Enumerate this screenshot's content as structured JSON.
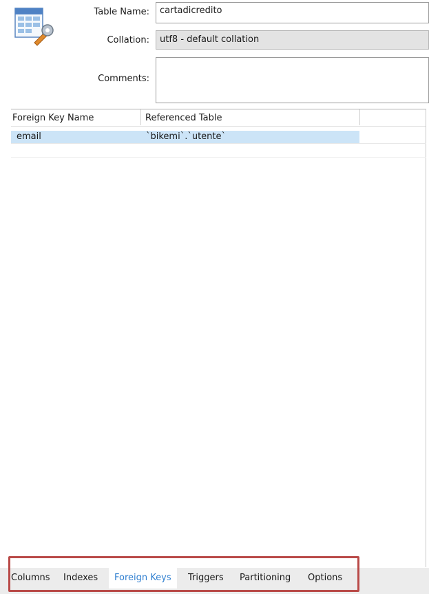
{
  "header": {
    "table_name_label": "Table Name:",
    "table_name_value": "cartadicredito",
    "collation_label": "Collation:",
    "collation_value": "utf8 - default collation",
    "comments_label": "Comments:",
    "comments_value": ""
  },
  "foreign_keys": {
    "columns": [
      "Foreign Key Name",
      "Referenced Table"
    ],
    "rows": [
      {
        "name": "email",
        "referenced_table": "`bikemi`.`utente`"
      }
    ]
  },
  "tabs": [
    "Columns",
    "Indexes",
    "Foreign Keys",
    "Triggers",
    "Partitioning",
    "Options"
  ],
  "active_tab": "Foreign Keys",
  "colors": {
    "selected_row": "#cce4f7",
    "active_tab_text": "#2f7fd0",
    "highlight_box": "#b94a48"
  },
  "icons": {
    "table": "table-settings-icon"
  }
}
